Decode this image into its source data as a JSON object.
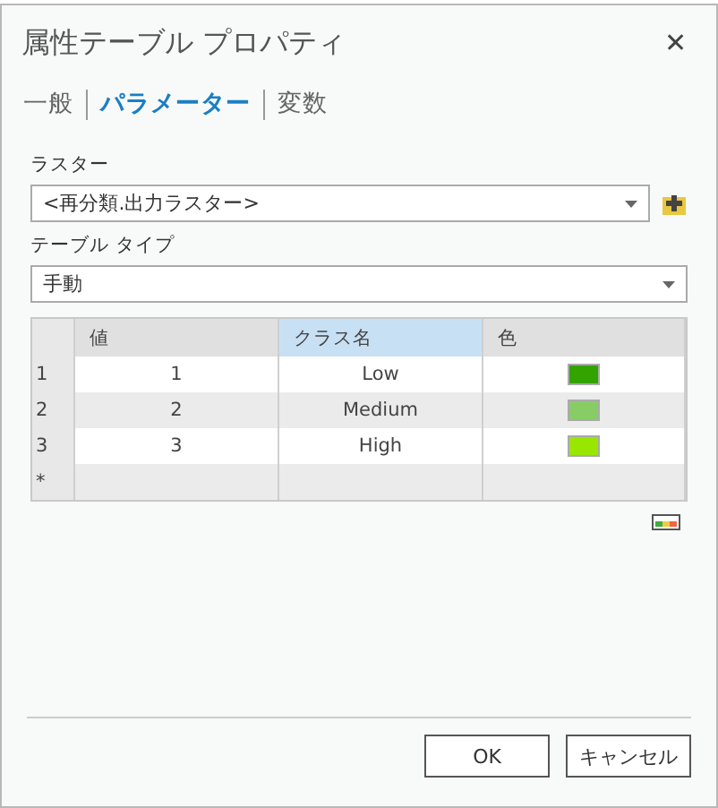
{
  "window": {
    "title": "属性テーブル プロパティ",
    "close": "✕"
  },
  "tabs": [
    {
      "label": "一般",
      "selected": false
    },
    {
      "label": "パラメーター",
      "selected": true
    },
    {
      "label": "変数",
      "selected": false
    }
  ],
  "raster": {
    "label": "ラスター",
    "value": "<再分類.出力ラスター>"
  },
  "table_type": {
    "label": "テーブル タイプ",
    "value": "手動"
  },
  "table": {
    "columns": [
      {
        "label": "値",
        "selected": false
      },
      {
        "label": "クラス名",
        "selected": true
      },
      {
        "label": "色",
        "selected": false
      }
    ],
    "rows": [
      {
        "index": "1",
        "value": "1",
        "class_name": "Low",
        "color": "#33a300"
      },
      {
        "index": "2",
        "value": "2",
        "class_name": "Medium",
        "color": "#88cc66"
      },
      {
        "index": "3",
        "value": "3",
        "class_name": "High",
        "color": "#99e600"
      }
    ],
    "new_row_marker": "*"
  },
  "buttons": [
    "OK",
    "キャンセル"
  ]
}
